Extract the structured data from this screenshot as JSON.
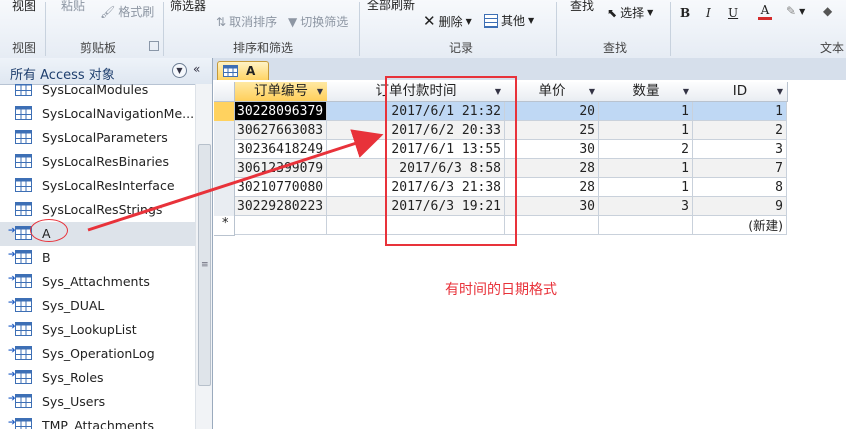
{
  "ribbon": {
    "groups": {
      "view": {
        "button": "视图",
        "label": "视图"
      },
      "clipboard": {
        "paste": "粘贴",
        "format_painter": "格式刷",
        "label": "剪贴板"
      },
      "sort_filter": {
        "filter": "筛选器",
        "remove_sort": "取消排序",
        "toggle_filter": "切换筛选",
        "label": "排序和筛选"
      },
      "records": {
        "refresh_all": "全部刷新",
        "delete": "删除",
        "more": "其他",
        "label": "记录"
      },
      "find": {
        "find": "查找",
        "select": "选择",
        "label": "查找"
      },
      "text_format": {
        "bold": "B",
        "italic": "I",
        "underline": "U",
        "font_color": "A",
        "label": "文本"
      }
    },
    "colors": {
      "font_color_bar": "#d42b2b"
    }
  },
  "nav": {
    "title": "所有 Access 对象",
    "items": [
      {
        "name": "SysLocalModules",
        "linked": false
      },
      {
        "name": "SysLocalNavigationMe...",
        "linked": false
      },
      {
        "name": "SysLocalParameters",
        "linked": false
      },
      {
        "name": "SysLocalResBinaries",
        "linked": false
      },
      {
        "name": "SysLocalResInterface",
        "linked": false
      },
      {
        "name": "SysLocalResStrings",
        "linked": false
      },
      {
        "name": "A",
        "linked": true,
        "selected": true
      },
      {
        "name": "B",
        "linked": true
      },
      {
        "name": "Sys_Attachments",
        "linked": true
      },
      {
        "name": "Sys_DUAL",
        "linked": true
      },
      {
        "name": "Sys_LookupList",
        "linked": true
      },
      {
        "name": "Sys_OperationLog",
        "linked": true
      },
      {
        "name": "Sys_Roles",
        "linked": true
      },
      {
        "name": "Sys_Users",
        "linked": true
      },
      {
        "name": "TMP_Attachments",
        "linked": true
      }
    ]
  },
  "document": {
    "tab": "A",
    "columns": [
      "订单编号",
      "订单付款时间",
      "单价",
      "数量",
      "ID"
    ],
    "rows": [
      [
        "30228096379",
        "2017/6/1 21:32",
        "20",
        "1",
        "1"
      ],
      [
        "30627663083",
        "2017/6/2 20:33",
        "25",
        "1",
        "2"
      ],
      [
        "30236418249",
        "2017/6/1 13:55",
        "30",
        "2",
        "3"
      ],
      [
        "30612399079",
        "2017/6/3 8:58",
        "28",
        "1",
        "7"
      ],
      [
        "30210770080",
        "2017/6/3 21:38",
        "28",
        "1",
        "8"
      ],
      [
        "30229280223",
        "2017/6/3 19:21",
        "30",
        "3",
        "9"
      ]
    ],
    "new_row_marker": "*",
    "new_row_label": "(新建)"
  },
  "annotation": {
    "note": "有时间的日期格式",
    "color": "#e8323a"
  }
}
